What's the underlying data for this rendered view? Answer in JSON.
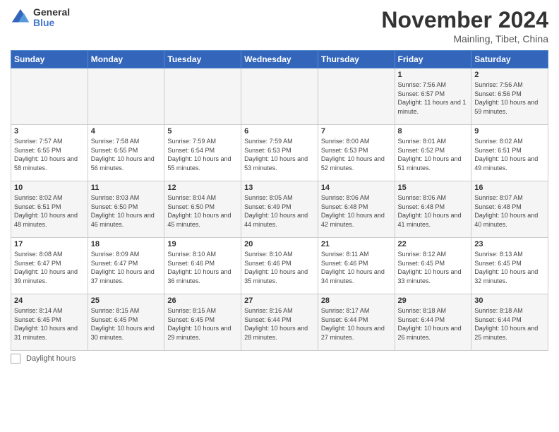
{
  "logo": {
    "general": "General",
    "blue": "Blue"
  },
  "header": {
    "month": "November 2024",
    "location": "Mainling, Tibet, China"
  },
  "weekdays": [
    "Sunday",
    "Monday",
    "Tuesday",
    "Wednesday",
    "Thursday",
    "Friday",
    "Saturday"
  ],
  "footer": {
    "label": "Daylight hours"
  },
  "days": [
    {
      "date": "",
      "sunrise": "",
      "sunset": "",
      "daylight": ""
    },
    {
      "date": "",
      "sunrise": "",
      "sunset": "",
      "daylight": ""
    },
    {
      "date": "",
      "sunrise": "",
      "sunset": "",
      "daylight": ""
    },
    {
      "date": "",
      "sunrise": "",
      "sunset": "",
      "daylight": ""
    },
    {
      "date": "",
      "sunrise": "",
      "sunset": "",
      "daylight": ""
    },
    {
      "date": "1",
      "sunrise": "7:56 AM",
      "sunset": "6:57 PM",
      "daylight": "11 hours and 1 minute."
    },
    {
      "date": "2",
      "sunrise": "7:56 AM",
      "sunset": "6:56 PM",
      "daylight": "10 hours and 59 minutes."
    },
    {
      "date": "3",
      "sunrise": "7:57 AM",
      "sunset": "6:55 PM",
      "daylight": "10 hours and 58 minutes."
    },
    {
      "date": "4",
      "sunrise": "7:58 AM",
      "sunset": "6:55 PM",
      "daylight": "10 hours and 56 minutes."
    },
    {
      "date": "5",
      "sunrise": "7:59 AM",
      "sunset": "6:54 PM",
      "daylight": "10 hours and 55 minutes."
    },
    {
      "date": "6",
      "sunrise": "7:59 AM",
      "sunset": "6:53 PM",
      "daylight": "10 hours and 53 minutes."
    },
    {
      "date": "7",
      "sunrise": "8:00 AM",
      "sunset": "6:53 PM",
      "daylight": "10 hours and 52 minutes."
    },
    {
      "date": "8",
      "sunrise": "8:01 AM",
      "sunset": "6:52 PM",
      "daylight": "10 hours and 51 minutes."
    },
    {
      "date": "9",
      "sunrise": "8:02 AM",
      "sunset": "6:51 PM",
      "daylight": "10 hours and 49 minutes."
    },
    {
      "date": "10",
      "sunrise": "8:02 AM",
      "sunset": "6:51 PM",
      "daylight": "10 hours and 48 minutes."
    },
    {
      "date": "11",
      "sunrise": "8:03 AM",
      "sunset": "6:50 PM",
      "daylight": "10 hours and 46 minutes."
    },
    {
      "date": "12",
      "sunrise": "8:04 AM",
      "sunset": "6:50 PM",
      "daylight": "10 hours and 45 minutes."
    },
    {
      "date": "13",
      "sunrise": "8:05 AM",
      "sunset": "6:49 PM",
      "daylight": "10 hours and 44 minutes."
    },
    {
      "date": "14",
      "sunrise": "8:06 AM",
      "sunset": "6:48 PM",
      "daylight": "10 hours and 42 minutes."
    },
    {
      "date": "15",
      "sunrise": "8:06 AM",
      "sunset": "6:48 PM",
      "daylight": "10 hours and 41 minutes."
    },
    {
      "date": "16",
      "sunrise": "8:07 AM",
      "sunset": "6:48 PM",
      "daylight": "10 hours and 40 minutes."
    },
    {
      "date": "17",
      "sunrise": "8:08 AM",
      "sunset": "6:47 PM",
      "daylight": "10 hours and 39 minutes."
    },
    {
      "date": "18",
      "sunrise": "8:09 AM",
      "sunset": "6:47 PM",
      "daylight": "10 hours and 37 minutes."
    },
    {
      "date": "19",
      "sunrise": "8:10 AM",
      "sunset": "6:46 PM",
      "daylight": "10 hours and 36 minutes."
    },
    {
      "date": "20",
      "sunrise": "8:10 AM",
      "sunset": "6:46 PM",
      "daylight": "10 hours and 35 minutes."
    },
    {
      "date": "21",
      "sunrise": "8:11 AM",
      "sunset": "6:46 PM",
      "daylight": "10 hours and 34 minutes."
    },
    {
      "date": "22",
      "sunrise": "8:12 AM",
      "sunset": "6:45 PM",
      "daylight": "10 hours and 33 minutes."
    },
    {
      "date": "23",
      "sunrise": "8:13 AM",
      "sunset": "6:45 PM",
      "daylight": "10 hours and 32 minutes."
    },
    {
      "date": "24",
      "sunrise": "8:14 AM",
      "sunset": "6:45 PM",
      "daylight": "10 hours and 31 minutes."
    },
    {
      "date": "25",
      "sunrise": "8:15 AM",
      "sunset": "6:45 PM",
      "daylight": "10 hours and 30 minutes."
    },
    {
      "date": "26",
      "sunrise": "8:15 AM",
      "sunset": "6:45 PM",
      "daylight": "10 hours and 29 minutes."
    },
    {
      "date": "27",
      "sunrise": "8:16 AM",
      "sunset": "6:44 PM",
      "daylight": "10 hours and 28 minutes."
    },
    {
      "date": "28",
      "sunrise": "8:17 AM",
      "sunset": "6:44 PM",
      "daylight": "10 hours and 27 minutes."
    },
    {
      "date": "29",
      "sunrise": "8:18 AM",
      "sunset": "6:44 PM",
      "daylight": "10 hours and 26 minutes."
    },
    {
      "date": "30",
      "sunrise": "8:18 AM",
      "sunset": "6:44 PM",
      "daylight": "10 hours and 25 minutes."
    }
  ]
}
